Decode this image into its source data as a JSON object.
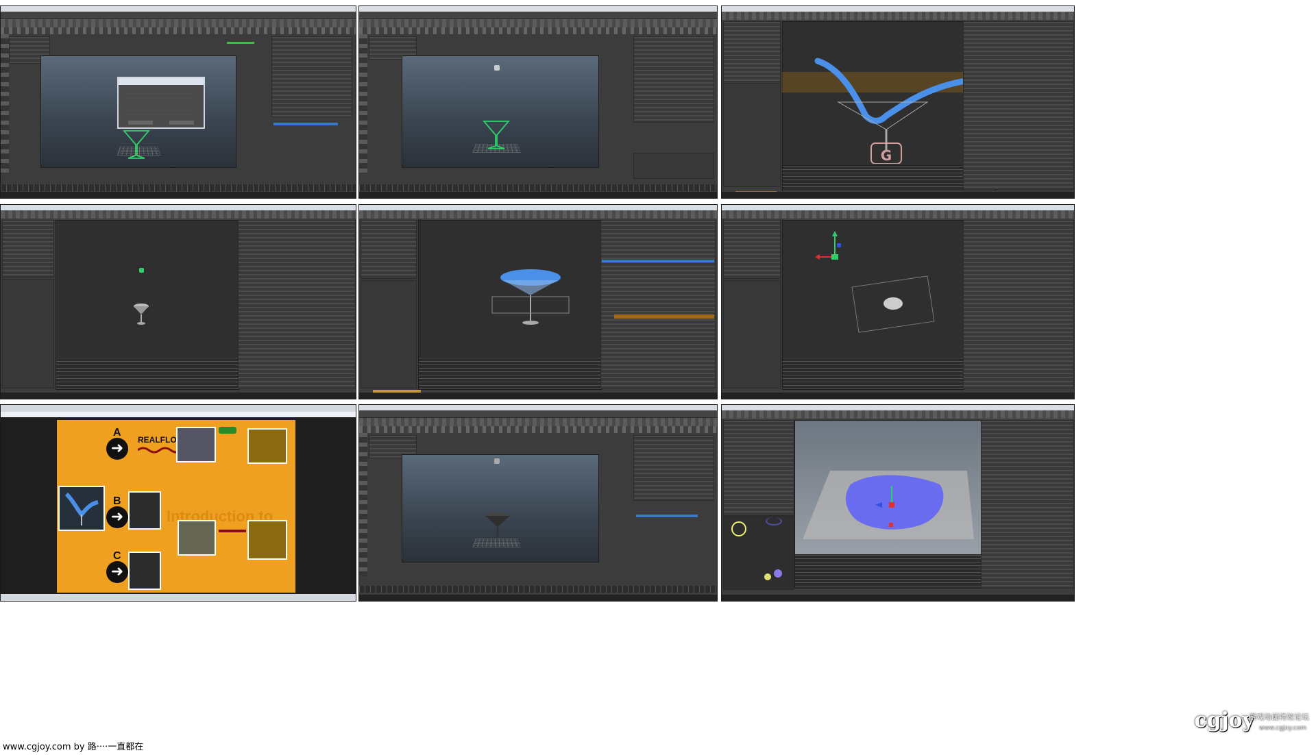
{
  "footer": {
    "caption": "www.cgjoy.com by 路····一直都在"
  },
  "watermark": {
    "brand": "cgjoy",
    "subtitle": "游戏动画特效论坛",
    "url": "www.cgjoy.com"
  },
  "slide": {
    "labels": [
      "A",
      "B",
      "C"
    ],
    "logo_text": "REALFLOW",
    "faded_text": "Introduction to"
  },
  "colors": {
    "maya_bg": "#3c3c3c",
    "slide_bg": "#f0a020",
    "fluid_blue": "#4a90e8",
    "mesh_purple": "#6a6cf0",
    "glass_green": "#2fd06a"
  }
}
